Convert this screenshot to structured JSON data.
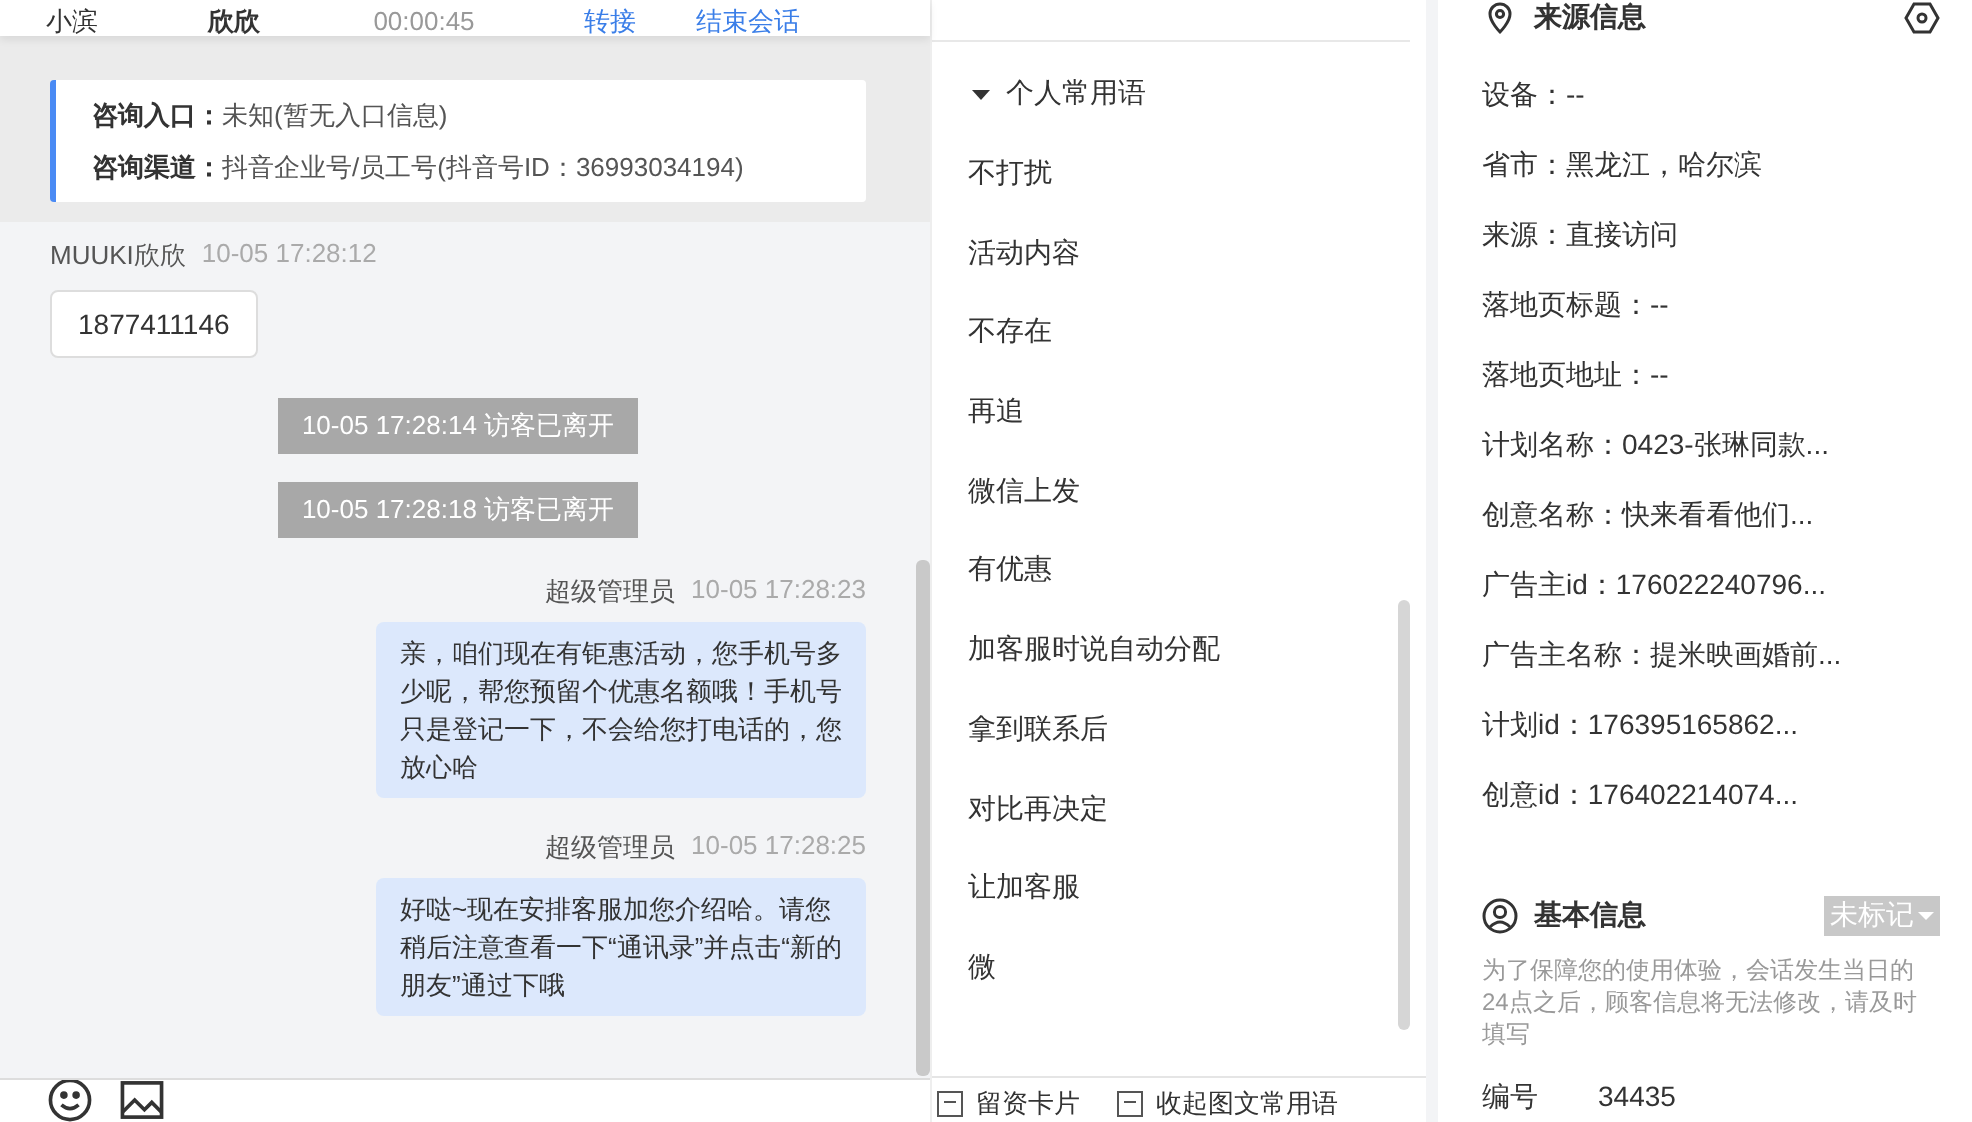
{
  "header": {
    "items": [
      "小滨",
      "欣欣",
      "00:00:45"
    ],
    "actions": [
      "转接",
      "结束会话"
    ]
  },
  "entry_card": {
    "rows": [
      {
        "label": "咨询入口：",
        "value": "未知(暂无入口信息)"
      },
      {
        "label": "咨询渠道：",
        "value": "抖音企业号/员工号(抖音号ID：36993034194)"
      }
    ]
  },
  "messages": [
    {
      "kind": "visitor",
      "name": "MUUKI欣欣",
      "time": "10-05 17:28:12",
      "text": "1877411146"
    },
    {
      "kind": "system",
      "text": "10-05 17:28:14 访客已离开"
    },
    {
      "kind": "system",
      "text": "10-05 17:28:18 访客已离开"
    },
    {
      "kind": "agent",
      "name": "超级管理员",
      "time": "10-05 17:28:23",
      "text": "亲，咱们现在有钜惠活动，您手机号多少呢，帮您预留个优惠名额哦！手机号只是登记一下，不会给您打电话的，您放心哈"
    },
    {
      "kind": "agent",
      "name": "超级管理员",
      "time": "10-05 17:28:25",
      "text": "好哒~现在安排客服加您介绍哈。请您稍后注意查看一下“通讯录”并点击“新的朋友”通过下哦"
    }
  ],
  "phrases": {
    "group": {
      "title": "个人常用语",
      "expanded": true
    },
    "items": [
      "不打扰",
      "活动内容",
      "不存在",
      "再追",
      "微信上发",
      "有优惠",
      "加客服时说自动分配",
      "拿到联系后",
      "对比再决定",
      "让加客服",
      "微"
    ],
    "footer": [
      "留资卡片",
      "收起图文常用语"
    ]
  },
  "source_info": {
    "title": "来源信息",
    "rows": [
      "设备：--",
      "省市：黑龙江，哈尔滨",
      "来源：直接访问",
      "落地页标题：--",
      "落地页地址：--",
      "计划名称：0423-张琳同款...",
      "创意名称：快来看看他们...",
      "广告主id：176022240796...",
      "广告主名称：提米映画婚前...",
      "计划id：176395165862...",
      "创意id：176402214074..."
    ]
  },
  "basic_info": {
    "title": "基本信息",
    "tag": "未标记",
    "notice": "为了保障您的使用体验，会话发生当日的24点之后，顾客信息将无法修改，请及时填写",
    "fields": [
      {
        "label": "编号",
        "value": "34435"
      }
    ]
  }
}
